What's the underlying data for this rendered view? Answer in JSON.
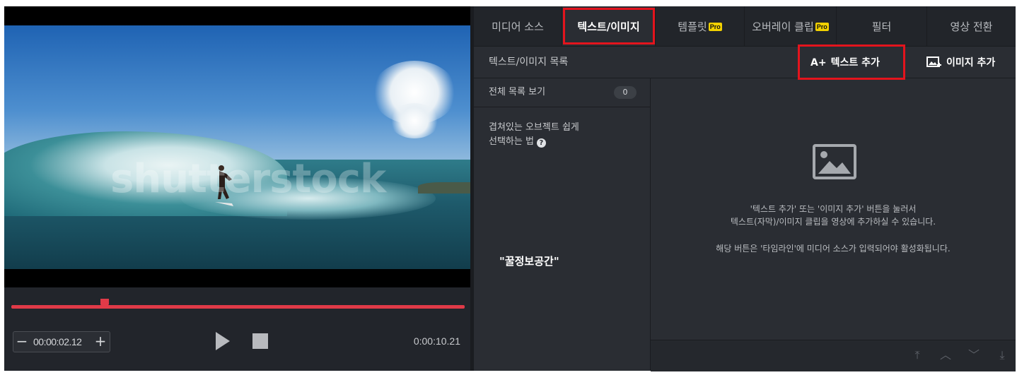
{
  "player": {
    "watermark": "shutterstock",
    "timecode": "00:00:02.12",
    "duration": "0:00:10.21",
    "minus_label": "−",
    "plus_label": "+",
    "progress": 0.2
  },
  "tabs": [
    {
      "label": "미디어 소스",
      "pro": ""
    },
    {
      "label": "텍스트/이미지",
      "pro": ""
    },
    {
      "label": "템플릿",
      "pro": "Pro"
    },
    {
      "label": "오버레이 클립",
      "pro": "Pro"
    },
    {
      "label": "필터",
      "pro": ""
    },
    {
      "label": "영상 전환",
      "pro": ""
    }
  ],
  "toolbar": {
    "list_title": "텍스트/이미지 목록",
    "add_text": "텍스트 추가",
    "add_text_icon": "A+",
    "add_image": "이미지 추가"
  },
  "sidebar": {
    "all_list": "전체 목록 보기",
    "count": "0",
    "help_line1": "겹쳐있는 오브젝트 쉽게",
    "help_line2": "선택하는 법",
    "help_icon": "?"
  },
  "overlay_text": "\"꿀정보공간\"",
  "empty_state": {
    "line1": "'텍스트 추가' 또는 '이미지 추가' 버튼을 눌러서",
    "line2": "텍스트(자막)/이미지 클립을 영상에 추가하실 수 있습니다.",
    "line3": "해당 버튼은 '타임라인'에 미디어 소스가 입력되어야 활성화됩니다."
  },
  "colors": {
    "highlight": "#e3141d",
    "timeline": "#e03a48",
    "pro_badge": "#f2d100"
  }
}
